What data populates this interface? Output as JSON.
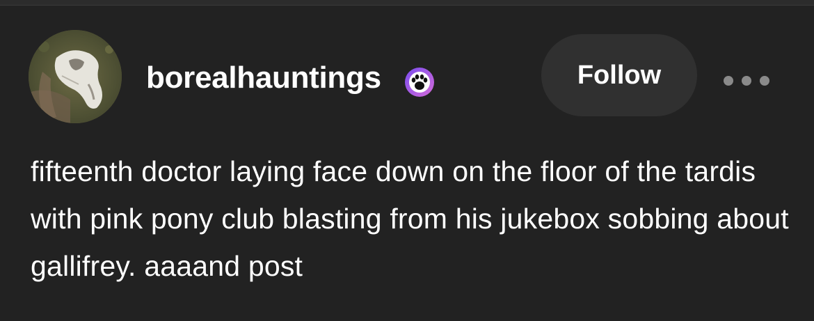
{
  "post": {
    "username": "borealhauntings",
    "badge_icon": "paw-print-badge-icon",
    "follow_label": "Follow",
    "more_icon": "more-options-icon",
    "text": "fifteenth doctor laying face down on the floor of the tardis with pink pony club blasting from his jukebox sobbing about gallifrey. aaaand post"
  },
  "colors": {
    "background": "#222222",
    "text": "#ffffff",
    "follow_button_bg": "#303030",
    "more_dots": "#8a8a8a",
    "badge_gradient_start": "#7b4df0",
    "badge_gradient_end": "#d36ad8"
  }
}
